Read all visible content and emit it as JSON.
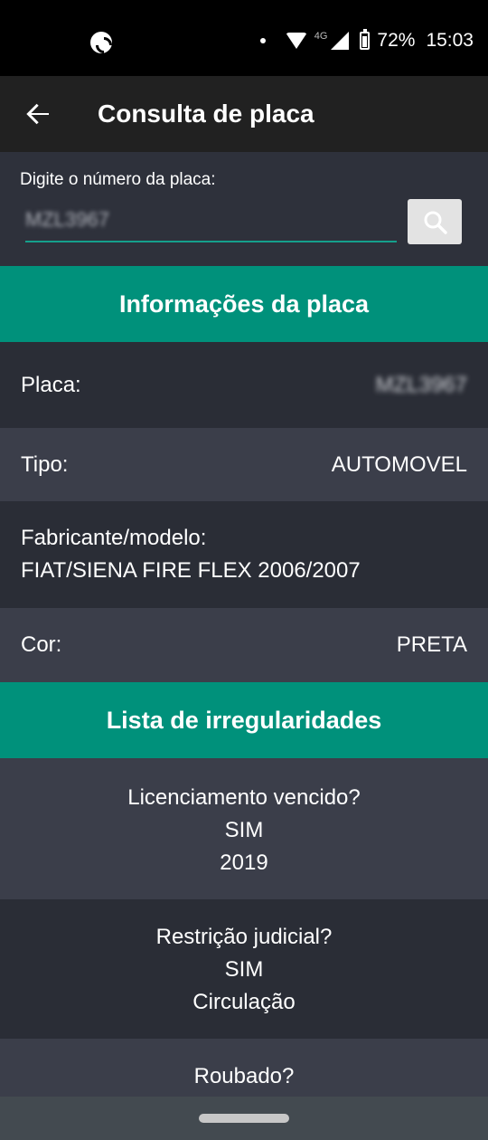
{
  "status_bar": {
    "battery": "72%",
    "time": "15:03",
    "network": "4G"
  },
  "app_bar": {
    "title": "Consulta de placa"
  },
  "search": {
    "label": "Digite o número da placa:",
    "value": "MZL3967"
  },
  "info": {
    "header": "Informações da placa",
    "placa_label": "Placa:",
    "placa_value": "MZL3967",
    "tipo_label": "Tipo:",
    "tipo_value": "AUTOMOVEL",
    "fabricante_label": "Fabricante/modelo:",
    "fabricante_value": "FIAT/SIENA FIRE FLEX 2006/2007",
    "cor_label": "Cor:",
    "cor_value": "PRETA"
  },
  "irregularities": {
    "header": "Lista de irregularidades",
    "items": [
      {
        "question": "Licenciamento vencido?",
        "answer": "SIM",
        "detail": "2019"
      },
      {
        "question": "Restrição judicial?",
        "answer": "SIM",
        "detail": "Circulação"
      },
      {
        "question": "Roubado?"
      }
    ]
  },
  "colors": {
    "accent": "#00917b",
    "input_underline": "#15a08c",
    "app_bar": "#212121",
    "row_dark": "#2a2d36",
    "row_light": "#3b3e4a"
  }
}
